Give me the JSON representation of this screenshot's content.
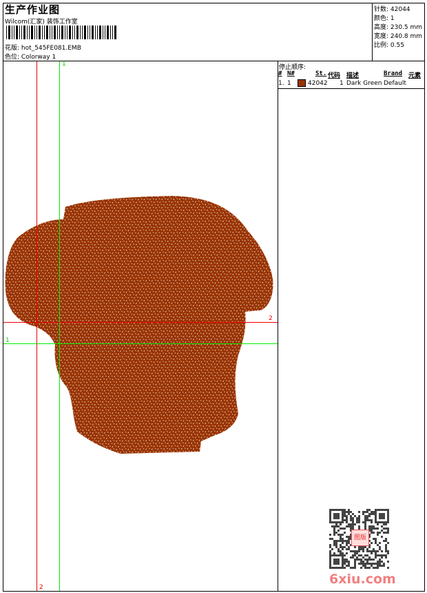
{
  "header": {
    "title": "生产作业图",
    "company": "Wilcom(汇家) 装饰工作室",
    "design_label": "花版:",
    "design_value": "hot_545FE081.EMB",
    "colorway_label": "色位:",
    "colorway_value": "Colorway 1"
  },
  "info": {
    "stitches": "针数: 42044",
    "colors": "颜色: 1",
    "height": "高度: 230.5 mm",
    "width": "宽度: 240.8 mm",
    "scale": "比例: 0.55"
  },
  "stop_sequence": {
    "title": "停止顺序:",
    "columns": [
      "#",
      "N#",
      "St.",
      "代码",
      "描述",
      "Brand",
      "元素"
    ],
    "rows": [
      {
        "index": "1.",
        "needle": "1",
        "stitches": "42042",
        "code": "1",
        "description": "Dark Green",
        "brand": "Default",
        "swatch": "#993300"
      }
    ]
  },
  "guides": {
    "v1_label": "1",
    "v2_label": "2",
    "h1_label": "1",
    "h2_label": "2",
    "guide1_color": "#00ee00",
    "guide2_color": "#ee0000"
  },
  "design_color": "#993300",
  "watermark": {
    "text": "6xiu.com",
    "stamp": "图版"
  }
}
